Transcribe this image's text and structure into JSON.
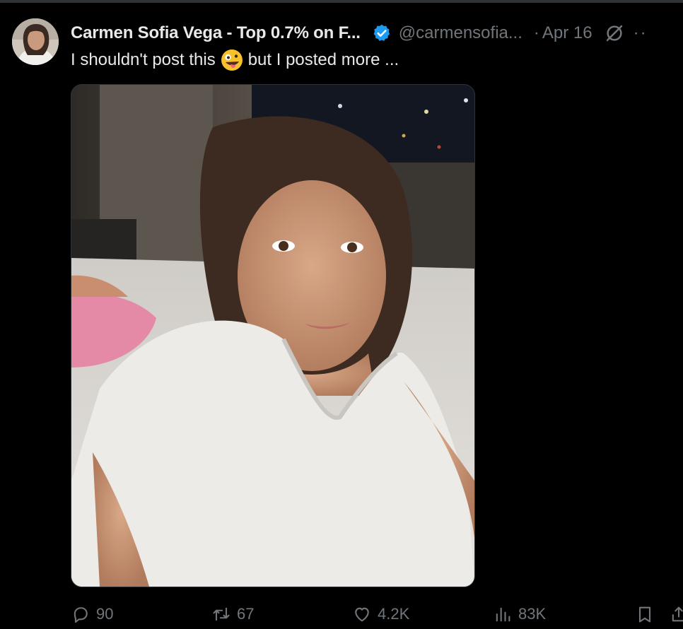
{
  "author": {
    "display_name": "Carmen Sofia Vega - Top 0.7% on F...",
    "handle": "@carmensofia...",
    "separator": "·",
    "date": "Apr 16",
    "more": "··"
  },
  "post": {
    "text_before_emoji": "I shouldn't post this",
    "emoji": "zany-face",
    "text_after_emoji": "but I posted more ..."
  },
  "actions": {
    "replies": "90",
    "reposts": "67",
    "likes": "4.2K",
    "views": "83K"
  },
  "colors": {
    "background": "#000000",
    "text": "#e7e9ea",
    "muted": "#71767b",
    "verified": "#1d9bf0",
    "divider": "#2f3336"
  },
  "icons": [
    "verified-badge-icon",
    "grok-icon",
    "reply-icon",
    "repost-icon",
    "like-icon",
    "views-icon",
    "bookmark-icon",
    "share-icon"
  ]
}
